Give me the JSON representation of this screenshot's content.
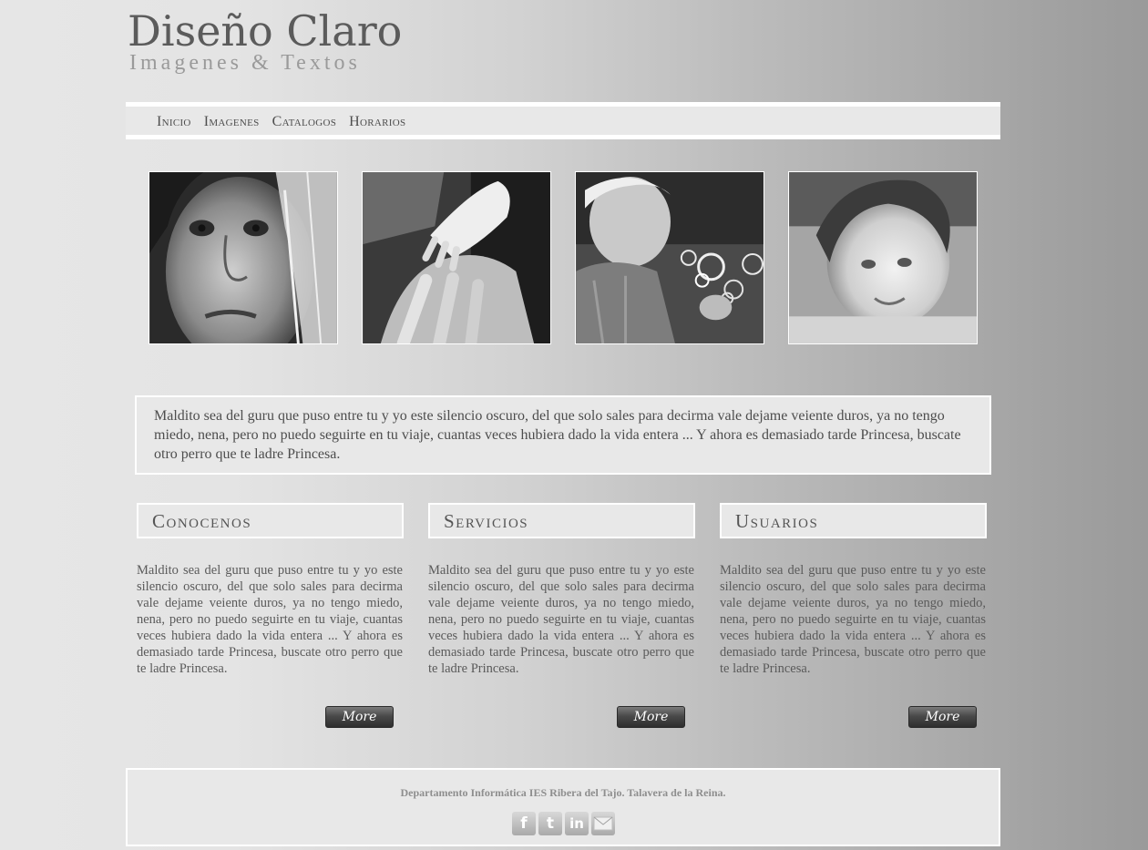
{
  "logo": {
    "title": "Diseño Claro",
    "subtitle": "Imagenes & Textos"
  },
  "nav": {
    "items": [
      "Inicio",
      "Imagenes",
      "Catalogos",
      "Horarios"
    ]
  },
  "intro": {
    "text": "Maldito sea del guru que puso entre tu y yo este silencio oscuro, del que solo sales para decirma vale dejame veiente duros, ya no tengo miedo, nena, pero no puedo seguirte en tu viaje, cuantas veces hubiera dado la vida entera ... Y ahora es demasiado tarde Princesa, buscate otro perro que te ladre Princesa."
  },
  "columns": [
    {
      "title": "Conocenos",
      "text": "Maldito sea del guru que puso entre tu y yo este silencio oscuro, del que solo sales para decirma vale dejame veiente duros, ya no tengo miedo, nena, pero no puedo seguirte en tu viaje, cuantas veces hubiera dado la vida entera ... Y ahora es demasiado tarde Princesa, buscate otro perro que te ladre Princesa.",
      "button": "More"
    },
    {
      "title": "Servicios",
      "text": "Maldito sea del guru que puso entre tu y yo este silencio oscuro, del que solo sales para decirma vale dejame veiente duros, ya no tengo miedo, nena, pero no puedo seguirte en tu viaje, cuantas veces hubiera dado la vida entera ... Y ahora es demasiado tarde Princesa, buscate otro perro que te ladre Princesa.",
      "button": "More"
    },
    {
      "title": "Usuarios",
      "text": "Maldito sea del guru que puso entre tu y yo este silencio oscuro, del que solo sales para decirma vale dejame veiente duros, ya no tengo miedo, nena, pero no puedo seguirte en tu viaje, cuantas veces hubiera dado la vida entera ... Y ahora es demasiado tarde Princesa, buscate otro perro que te ladre Princesa.",
      "button": "More"
    }
  ],
  "footer": {
    "text": "Departamento Informática IES Ribera del Tajo. Talavera de la Reina."
  },
  "social": {
    "icons": [
      "facebook-icon",
      "twitter-icon",
      "linkedin-icon",
      "mail-icon"
    ]
  }
}
